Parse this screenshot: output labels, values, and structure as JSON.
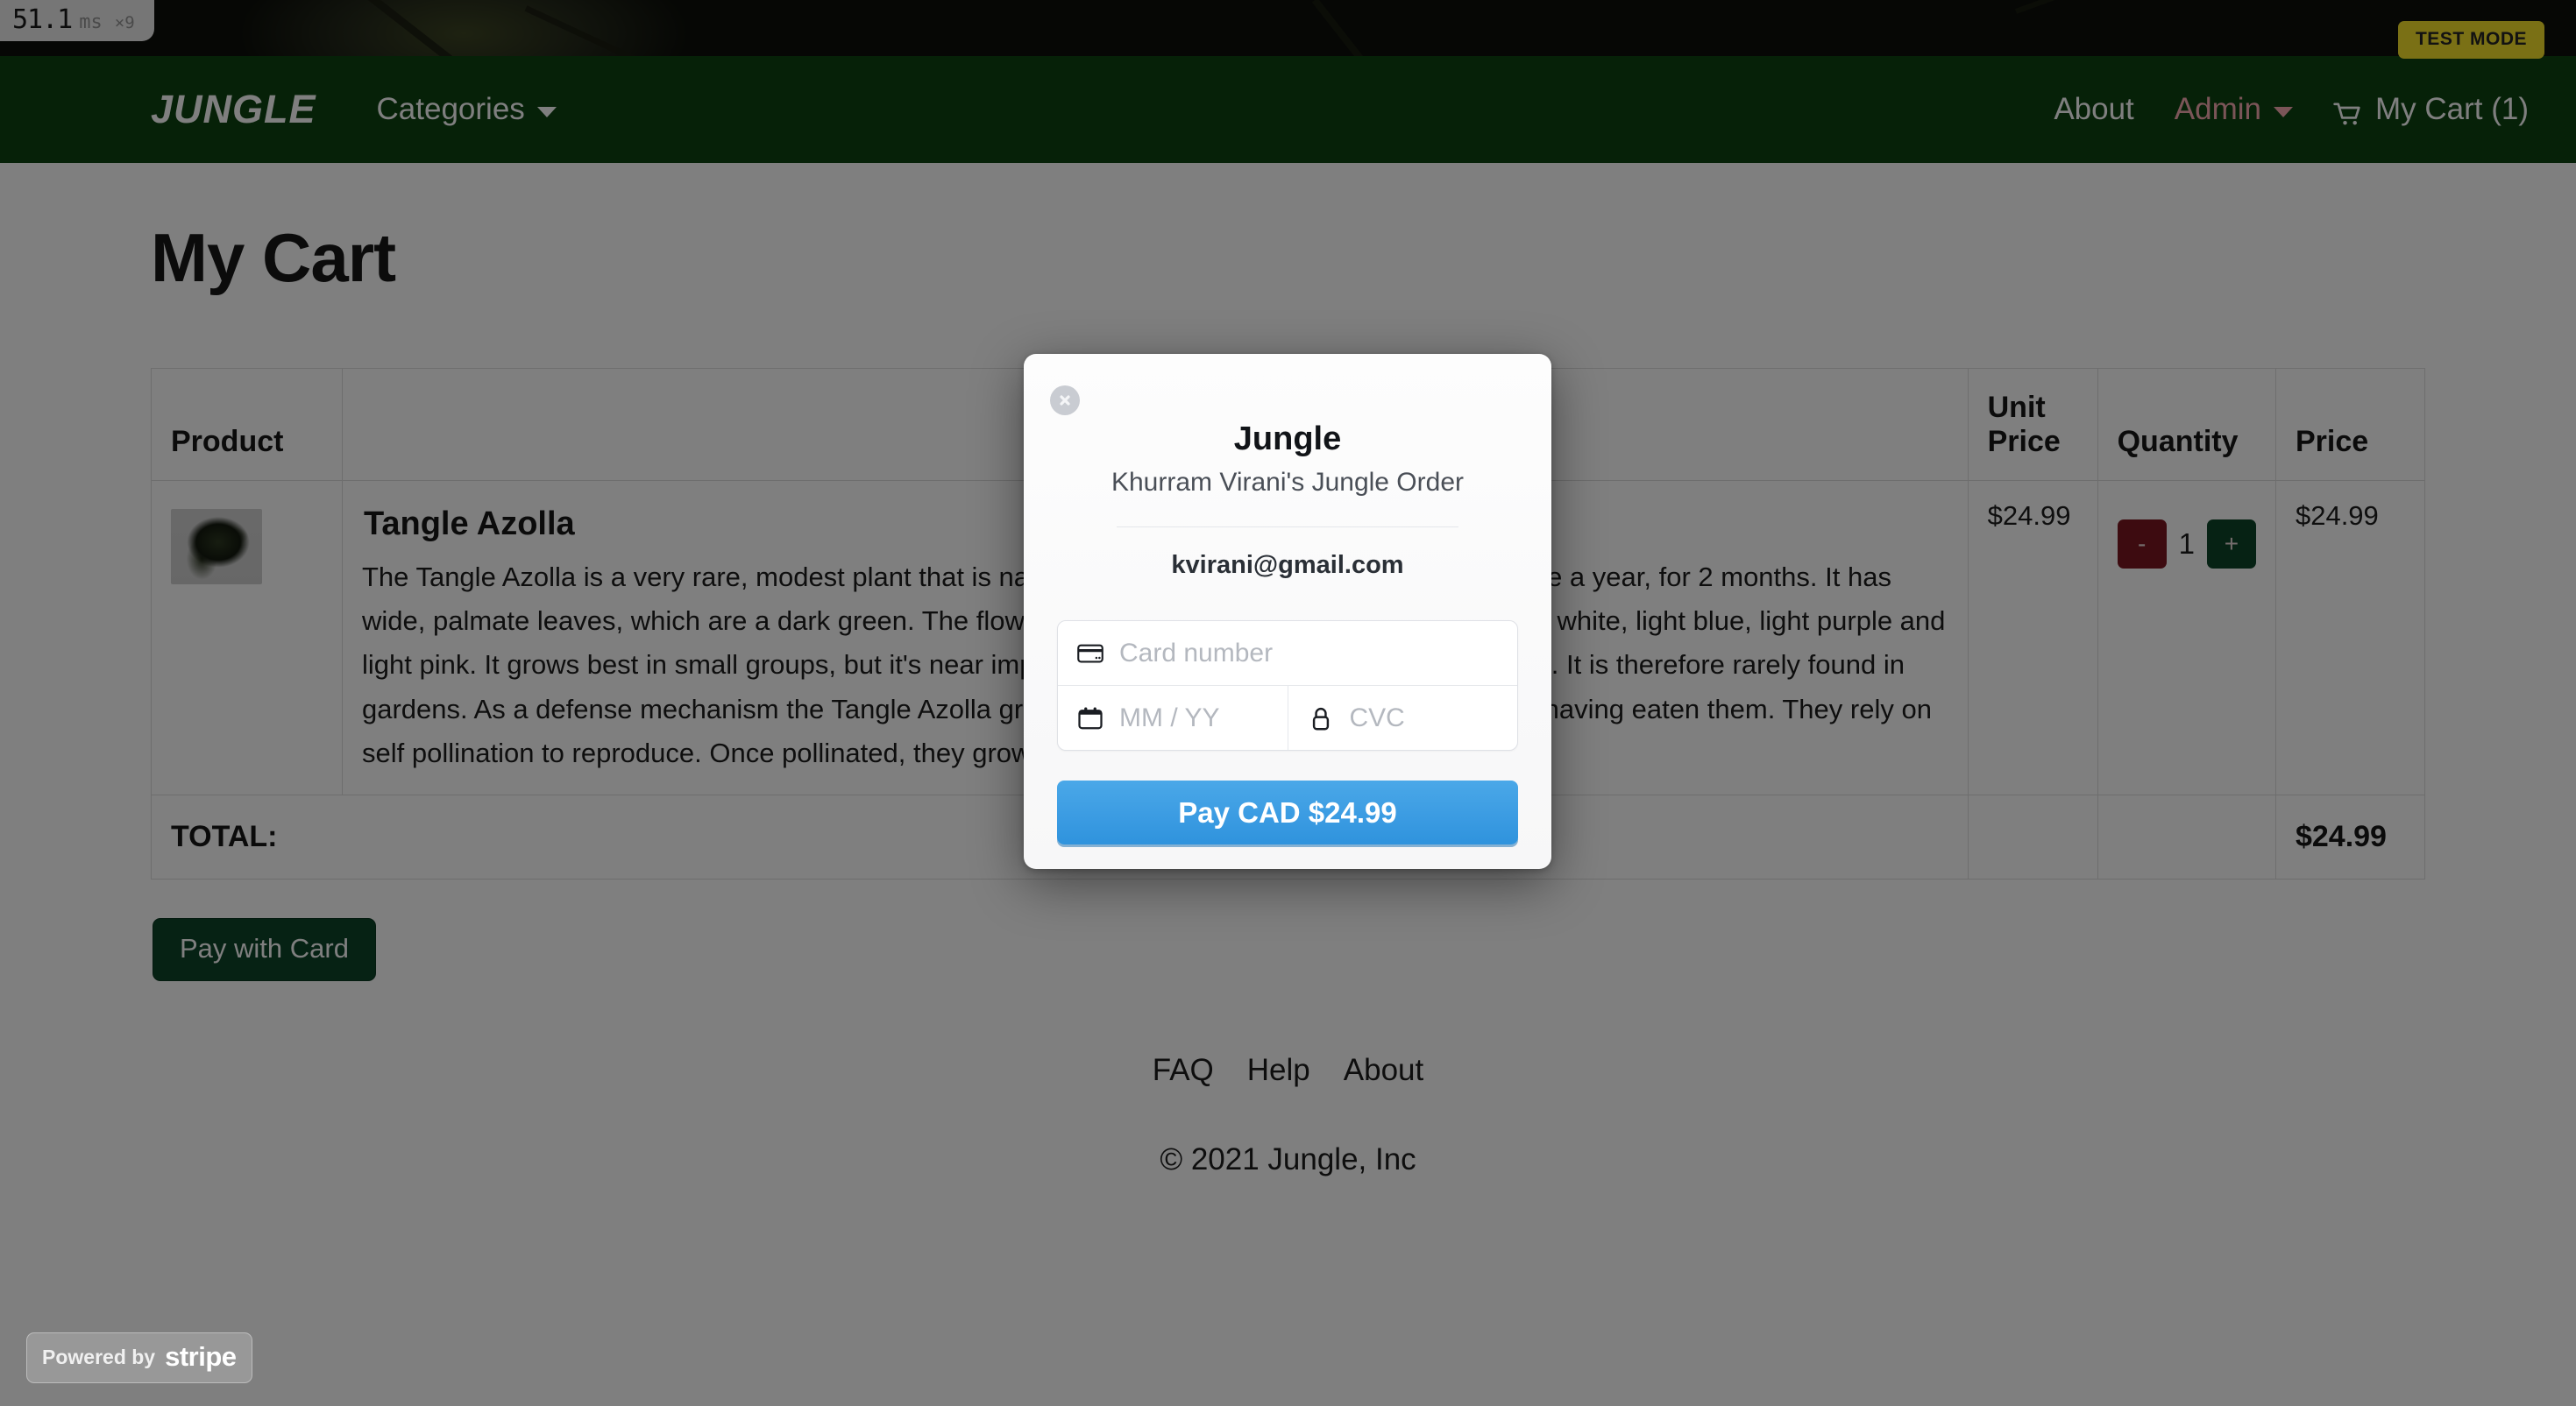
{
  "perf": {
    "ms": "51.1",
    "unit": "ms",
    "multiplier": "×9"
  },
  "badge": {
    "test_mode": "TEST MODE"
  },
  "nav": {
    "brand": "JUNGLE",
    "categories": "Categories",
    "about": "About",
    "admin": "Admin",
    "cart": "My Cart (1)",
    "brand_color": "#0c4210",
    "admin_color": "#f6aab1"
  },
  "page": {
    "title": "My Cart"
  },
  "table": {
    "headers": {
      "product": "Product",
      "blank1": "",
      "unit_price": "Unit Price",
      "quantity": "Quantity",
      "price": "Price"
    },
    "row": {
      "name": "Tangle Azolla",
      "description": "The Tangle Azolla is a very rare, modest plant that is native to the Malaysian jungles. It blooms once a year, for 2 months. It has wide, palmate leaves, which are a dark green. The flowers are tiny flowers, which can be light grey, white, light blue, light purple and light pink. It grows best in small groups, but it's near impossible to control and maintain their growth. It is therefore rarely found in gardens. As a defense mechanism the Tangle Azolla grow slippery leaves to prevent animals from having eaten them. They rely on self pollination to reproduce. Once pollinated, they grow delicious, small fruits.",
      "unit_price": "$24.99",
      "qty_minus": "-",
      "quantity": "1",
      "qty_plus": "+",
      "price": "$24.99"
    },
    "total_label": "TOTAL:",
    "total_value": "$24.99"
  },
  "actions": {
    "pay_with_card": "Pay with Card"
  },
  "footer": {
    "links": [
      "FAQ",
      "Help",
      "About"
    ],
    "copyright": "© 2021 Jungle, Inc"
  },
  "stripe_modal": {
    "merchant": "Jungle",
    "order_description": "Khurram Virani's Jungle Order",
    "email": "kvirani@gmail.com",
    "card_number_placeholder": "Card number",
    "expiry_placeholder": "MM / YY",
    "cvc_placeholder": "CVC",
    "pay_button": "Pay CAD $24.99",
    "accent_color": "#3d9de3"
  },
  "stripe_badge": {
    "powered_by": "Powered by",
    "wordmark": "stripe"
  }
}
